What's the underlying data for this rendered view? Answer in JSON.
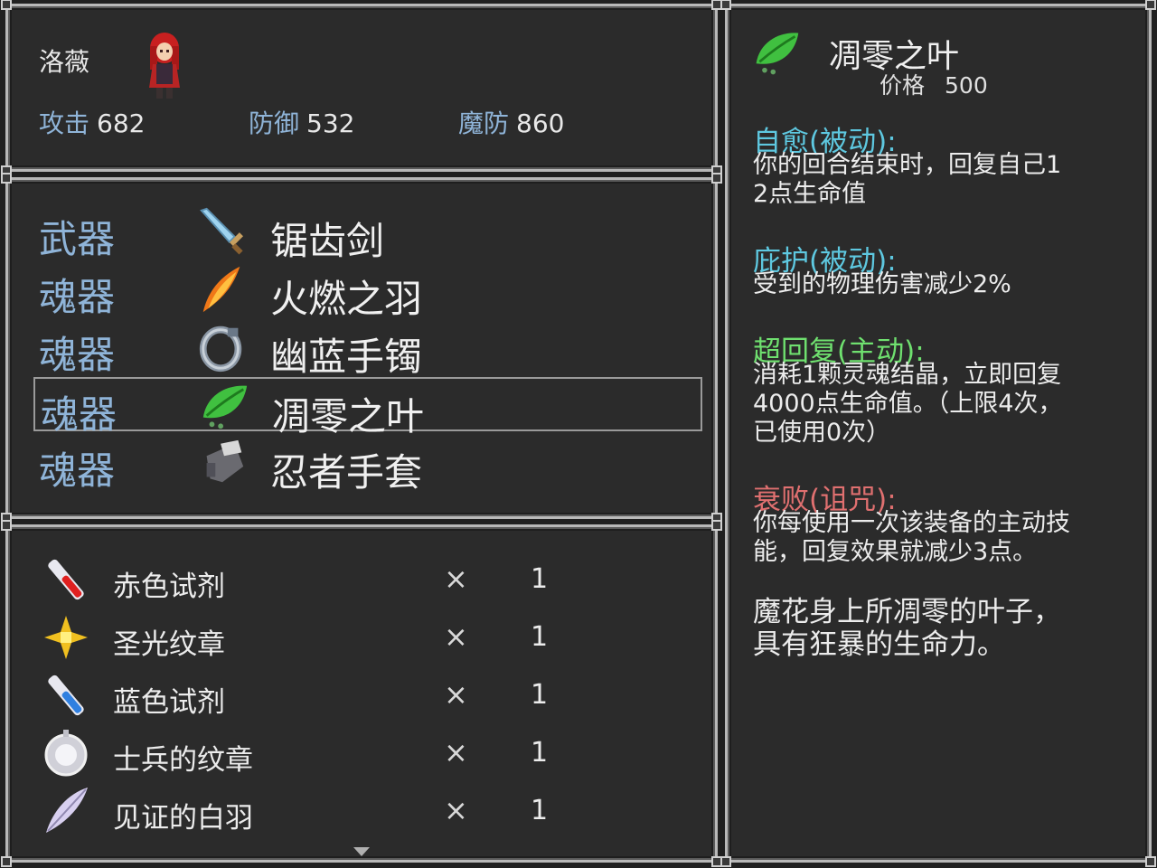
{
  "character": {
    "name": "洛薇",
    "stats": [
      {
        "label": "攻击",
        "value": "682"
      },
      {
        "label": "防御",
        "value": "532"
      },
      {
        "label": "魔防",
        "value": "860"
      }
    ]
  },
  "equipment": [
    {
      "slot": "武器",
      "name": "锯齿剑",
      "icon": "sword-icon"
    },
    {
      "slot": "魂器",
      "name": "火燃之羽",
      "icon": "flame-feather-icon"
    },
    {
      "slot": "魂器",
      "name": "幽蓝手镯",
      "icon": "bracelet-icon"
    },
    {
      "slot": "魂器",
      "name": "凋零之叶",
      "icon": "leaf-icon",
      "selected": true
    },
    {
      "slot": "魂器",
      "name": "忍者手套",
      "icon": "glove-icon"
    }
  ],
  "inventory": {
    "times_symbol": "×",
    "items": [
      {
        "name": "赤色试剂",
        "qty": "1",
        "icon": "red-potion-icon"
      },
      {
        "name": "圣光纹章",
        "qty": "1",
        "icon": "holy-emblem-icon"
      },
      {
        "name": "蓝色试剂",
        "qty": "1",
        "icon": "blue-potion-icon"
      },
      {
        "name": "士兵的纹章",
        "qty": "1",
        "icon": "soldier-emblem-icon"
      },
      {
        "name": "见证的白羽",
        "qty": "1",
        "icon": "white-feather-icon"
      }
    ]
  },
  "detail": {
    "title": "凋零之叶",
    "price_label": "价格",
    "price_value": "500",
    "skills": [
      {
        "title": "自愈(被动):",
        "color": "#5ec8e0",
        "lines": [
          "你的回合结束时，回复自己1",
          "2点生命值"
        ]
      },
      {
        "title": "庇护(被动):",
        "color": "#5ec8e0",
        "lines": [
          "受到的物理伤害减少2%"
        ]
      },
      {
        "title": "超回复(主动):",
        "color": "#6fe06f",
        "lines": [
          "消耗1颗灵魂结晶，立即回复",
          "4000点生命值。（上限4次，",
          "已使用0次）"
        ]
      },
      {
        "title": "衰败(诅咒):",
        "color": "#e07070",
        "lines": [
          "你每使用一次该装备的主动技",
          "能，回复效果就减少3点。"
        ]
      }
    ],
    "flavor": [
      "魔花身上所凋零的叶子，",
      "具有狂暴的生命力。"
    ]
  },
  "colors": {
    "label_blue": "#8fb4d8",
    "passive_cyan": "#5ec8e0",
    "active_green": "#6fe06f",
    "curse_red": "#e07070"
  }
}
